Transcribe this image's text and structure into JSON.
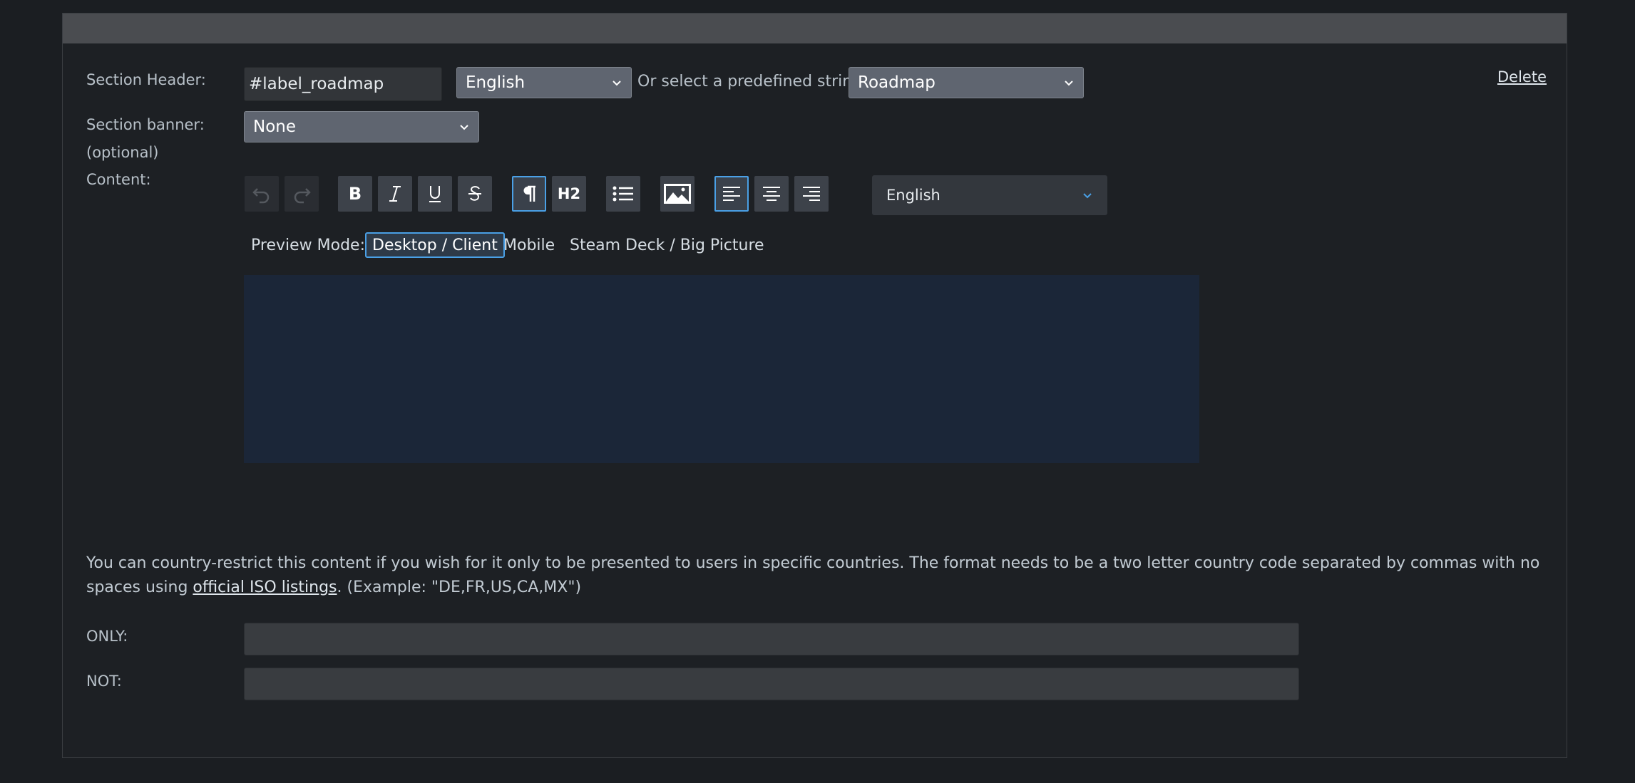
{
  "section": {
    "header_label": "Section Header:",
    "header_value": "#label_roadmap",
    "language_select": "English",
    "predefined_label": "Or select a predefined string:",
    "predefined_select": "Roadmap",
    "delete_label": "Delete",
    "banner_label": "Section banner:",
    "banner_optional": "(optional)",
    "banner_select": "None",
    "content_label": "Content:"
  },
  "toolbar": {
    "undo": "undo-icon",
    "redo": "redo-icon",
    "bold": "bold-icon",
    "italic": "italic-icon",
    "underline": "underline-icon",
    "strikethrough": "strikethrough-icon",
    "paragraph": "paragraph-icon",
    "h2_label": "H2",
    "list": "bullet-list-icon",
    "image": "image-icon",
    "align_left": "align-left-icon",
    "align_center": "align-center-icon",
    "align_right": "align-right-icon",
    "language_select": "English"
  },
  "preview": {
    "label": "Preview Mode:",
    "options": [
      "Desktop / Client",
      "Mobile",
      "Steam Deck / Big Picture"
    ],
    "selected": "Desktop / Client"
  },
  "country": {
    "description_1": "You can country-restrict this content if you wish for it only to be presented to users in specific countries. The format needs to be a two letter country code separated by commas with no",
    "description_2_before": "spaces using ",
    "description_link": "official ISO listings",
    "description_2_after": ". (Example: \"DE,FR,US,CA,MX\")",
    "only_label": "ONLY:",
    "only_value": "",
    "not_label": "NOT:",
    "not_value": ""
  },
  "colors": {
    "accent": "#4aa0e6",
    "background": "#1b1e22",
    "editor_bg": "#1b2638"
  }
}
